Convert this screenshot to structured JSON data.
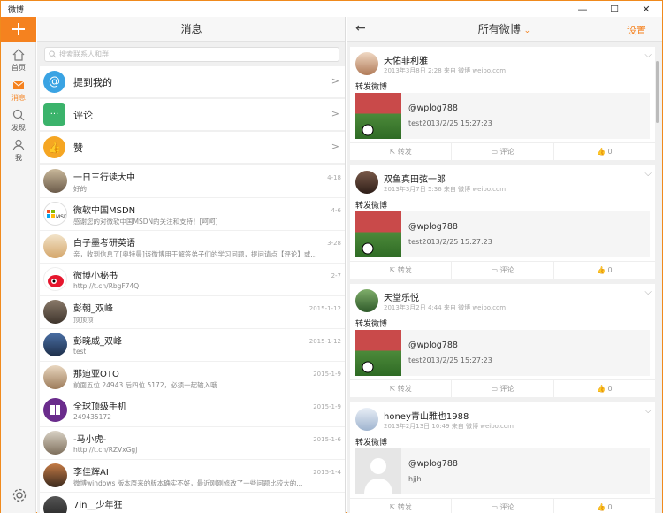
{
  "window": {
    "title": "微博"
  },
  "nav": {
    "items": [
      {
        "label": "首页"
      },
      {
        "label": "消息"
      },
      {
        "label": "发现"
      },
      {
        "label": "我"
      }
    ]
  },
  "messages": {
    "title": "消息",
    "search_placeholder": "搜索联系人和群",
    "categories": [
      {
        "label": "提到我的"
      },
      {
        "label": "评论"
      },
      {
        "label": "赞"
      }
    ],
    "rows": [
      {
        "name": "一日三行读大中",
        "preview": "好的",
        "time": "4-18"
      },
      {
        "name": "微软中国MSDN",
        "preview": "感谢您的对微软中国MSDN的关注和支持！[呵呵]",
        "time": "4-6"
      },
      {
        "name": "白子墨考研英语",
        "preview": "亲，收到信息了[奥特曼]该微博用于解答弟子们的学习问题，提问请点【评论】或...",
        "time": "3-28"
      },
      {
        "name": "微博小秘书",
        "preview": "http://t.cn/RbgF74Q",
        "time": "2-7"
      },
      {
        "name": "彭朝_双峰",
        "preview": "顶顶顶",
        "time": "2015-1-12"
      },
      {
        "name": "彭晓威_双峰",
        "preview": "test",
        "time": "2015-1-12"
      },
      {
        "name": "那迪亚OTO",
        "preview": "前面五位 24943 后四位 5172，必须一起输入哦",
        "time": "2015-1-9"
      },
      {
        "name": "全球顶级手机",
        "preview": "249435172",
        "time": "2015-1-9"
      },
      {
        "name": "-马小虎-",
        "preview": "http://t.cn/RZVxGgj",
        "time": "2015-1-6"
      },
      {
        "name": "李佳辉AI",
        "preview": "微博windows 版本原来的版本确实不好，最近刚刚修改了一些问题比较大的...",
        "time": "2015-1-4"
      },
      {
        "name": "7in__少年狂",
        "preview": "",
        "time": ""
      }
    ]
  },
  "weibo": {
    "back": "←",
    "title": "所有微博",
    "settings": "设置",
    "cards": [
      {
        "user": "天佑菲利雅",
        "meta": "2013年3月8日 2:28 来自 微博 weibo.com",
        "text": "转发微博",
        "quote_user": "@wplog788",
        "quote_text": "test2013/2/25 15:27:23",
        "repost": "转发",
        "comment": "评论",
        "like": "0"
      },
      {
        "user": "双鱼真田弦一郎",
        "meta": "2013年3月7日 5:36 来自 微博 weibo.com",
        "text": "转发微博",
        "quote_user": "@wplog788",
        "quote_text": "test2013/2/25 15:27:23",
        "repost": "转发",
        "comment": "评论",
        "like": "0"
      },
      {
        "user": "天堂乐悦",
        "meta": "2013年3月2日 4:44 来自 微博 weibo.com",
        "text": "转发微博",
        "quote_user": "@wplog788",
        "quote_text": "test2013/2/25 15:27:23",
        "repost": "转发",
        "comment": "评论",
        "like": "0"
      },
      {
        "user": "honey青山雅也1988",
        "meta": "2013年2月13日 10:49 来自 微博 weibo.com",
        "text": "转发微博",
        "quote_user": "@wplog788",
        "quote_text": "hjjh",
        "repost": "转发",
        "comment": "评论",
        "like": "0"
      }
    ]
  },
  "colors": {
    "accent": "#f5821f"
  }
}
